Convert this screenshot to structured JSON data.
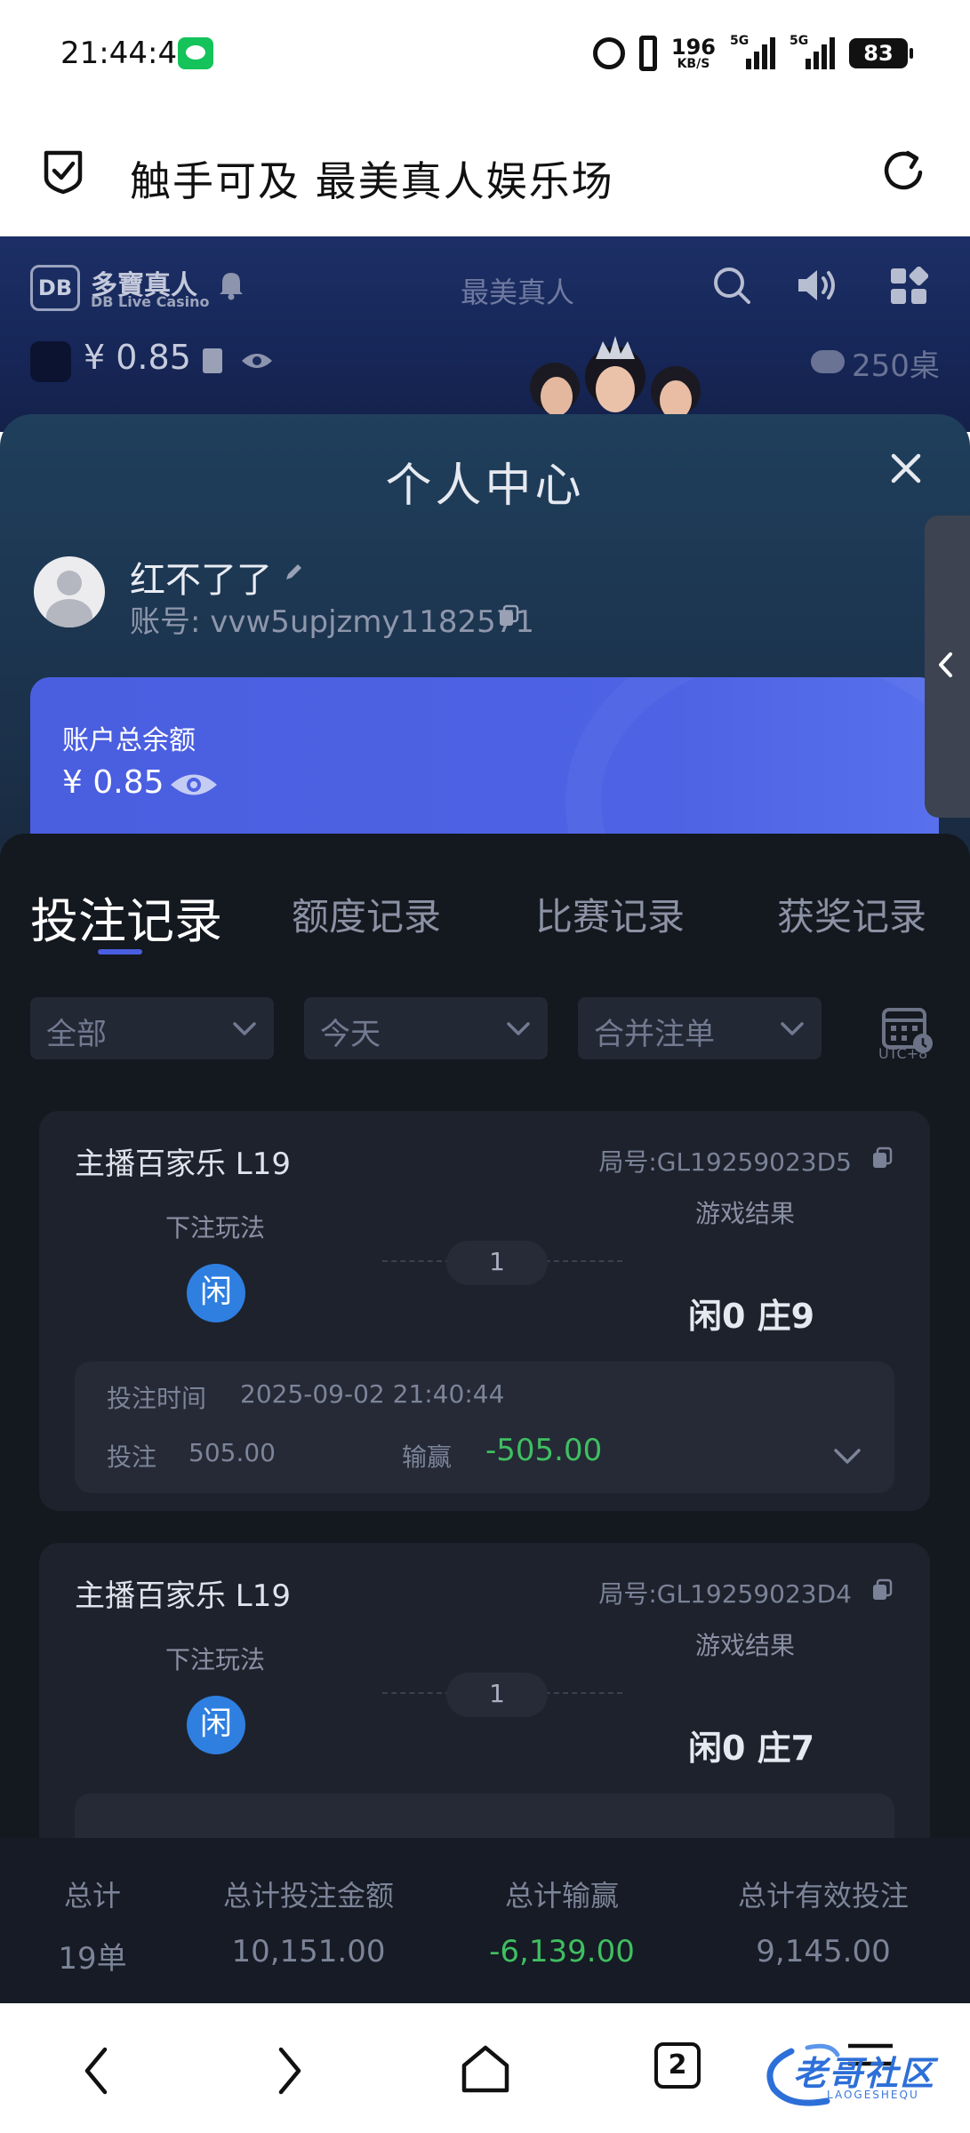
{
  "status_bar": {
    "time": "21:44:48",
    "net_speed": "196",
    "net_unit": "KB/S",
    "signal1": "5G",
    "signal2": "5G",
    "battery": "83"
  },
  "browser": {
    "title": "触手可及 最美真人娱乐场"
  },
  "game_header": {
    "logo": "DB",
    "brand": "多寶真人",
    "brand_sub": "DB Live Casino",
    "center_text": "最美真人",
    "balance": "¥ 0.85",
    "tables": "250桌"
  },
  "panel": {
    "title": "个人中心",
    "user_name": "红不了了",
    "account": "账号: vvw5upjzmy1182571",
    "balance_label": "账户总余额",
    "balance_amount": "¥ 0.85",
    "tabs": [
      "投注记录",
      "额度记录",
      "比赛记录",
      "获奖记录"
    ],
    "filters": [
      "全部",
      "今天",
      "合并注单"
    ],
    "timezone": "UTC+8"
  },
  "records": [
    {
      "game": "主播百家乐 L19",
      "round": "局号:GL19259023D5",
      "bet_label": "下注玩法",
      "bet_type": "闲",
      "count": "1",
      "result_label": "游戏结果",
      "result": "闲0 庄9",
      "time_label": "投注时间",
      "time": "2025-09-02 21:40:44",
      "bet_amount_label": "投注",
      "bet_amount": "505.00",
      "winloss_label": "输赢",
      "winloss": "-505.00"
    },
    {
      "game": "主播百家乐 L19",
      "round": "局号:GL19259023D4",
      "bet_label": "下注玩法",
      "bet_type": "闲",
      "count": "1",
      "result_label": "游戏结果",
      "result": "闲0 庄7"
    }
  ],
  "totals": {
    "labels": [
      "总计",
      "总计投注金额",
      "总计输赢",
      "总计有效投注"
    ],
    "values": [
      "19单",
      "10,151.00",
      "-6,139.00",
      "9,145.00"
    ]
  },
  "navbar": {
    "tab_count": "2"
  },
  "watermark": {
    "text": "老哥社区",
    "sub": "LAOGESHEQU"
  },
  "colors": {
    "accent": "#4a5ee0",
    "bet_chip": "#2e7fe0",
    "negative": "#3fbf61"
  }
}
